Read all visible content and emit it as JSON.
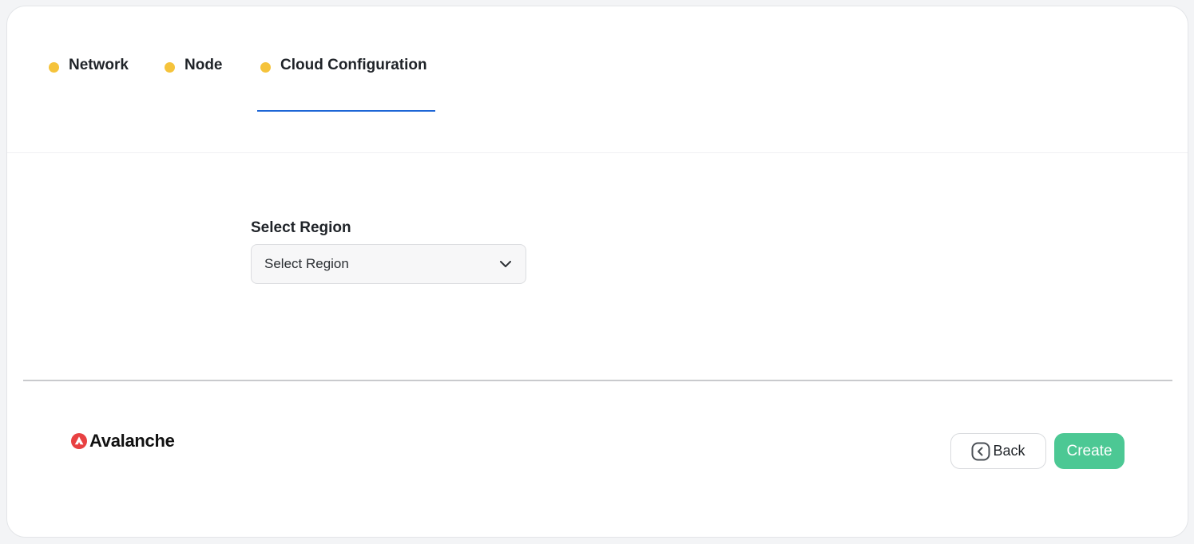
{
  "steps": [
    {
      "label": "Network",
      "dot_color": "#f5c33b"
    },
    {
      "label": "Node",
      "dot_color": "#f5c33b"
    },
    {
      "label": "Cloud Configuration",
      "dot_color": "#f5c33b",
      "active": true
    }
  ],
  "active_tab_underline_color": "#1e66d6",
  "form": {
    "region_label": "Select Region",
    "region_select_value": "Select Region",
    "region_select_icon": "chevron-down-icon"
  },
  "footer": {
    "brand": {
      "name": "Avalanche",
      "logo_icon": "avalanche-logo-icon",
      "logo_color": "#e84142"
    },
    "back_button": {
      "label": "Back",
      "icon": "chevron-left-icon"
    },
    "create_button": {
      "label": "Create",
      "color": "#4cc894"
    }
  }
}
